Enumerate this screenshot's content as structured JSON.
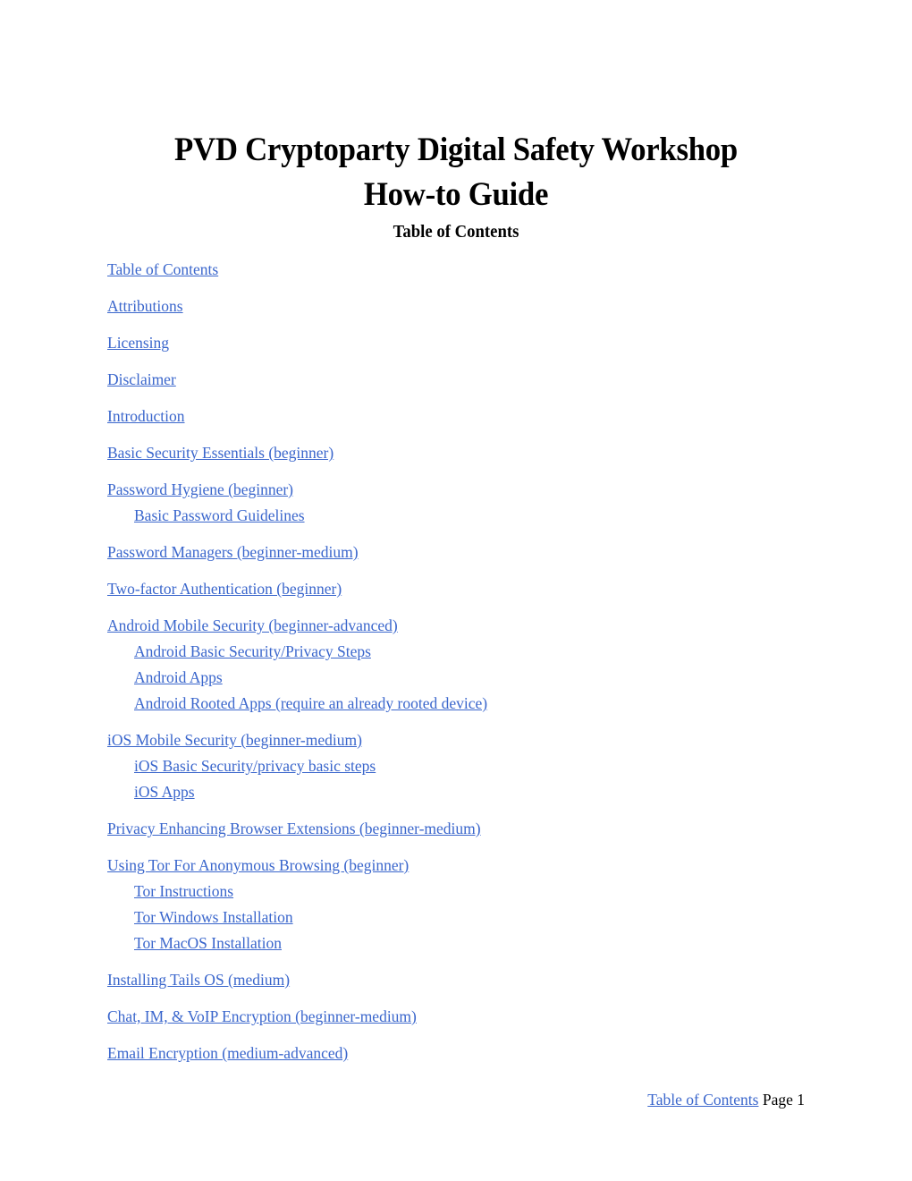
{
  "document": {
    "title_line_1": "PVD Cryptoparty Digital Safety Workshop",
    "title_line_2": "How-to Guide",
    "toc_heading": "Table of Contents",
    "link_color": "#3a66cc",
    "text_color": "#000000",
    "page_background": "#ffffff"
  },
  "toc": {
    "entries": [
      {
        "label": "Table of Contents",
        "level": 1
      },
      {
        "label": "Attributions",
        "level": 1
      },
      {
        "label": "Licensing",
        "level": 1
      },
      {
        "label": "Disclaimer",
        "level": 1
      },
      {
        "label": "Introduction",
        "level": 1
      },
      {
        "label": "Basic Security Essentials (beginner)",
        "level": 1
      },
      {
        "label": "Password Hygiene (beginner)",
        "level": 1
      },
      {
        "label": "Basic Password Guidelines",
        "level": 2
      },
      {
        "label": "Password Managers (beginner-medium)",
        "level": 1
      },
      {
        "label": "Two-factor Authentication (beginner)",
        "level": 1
      },
      {
        "label": "Android Mobile Security (beginner-advanced)",
        "level": 1
      },
      {
        "label": "Android Basic Security/Privacy Steps",
        "level": 2
      },
      {
        "label": "Android Apps",
        "level": 2
      },
      {
        "label": "Android Rooted Apps (require an already rooted device)",
        "level": 2
      },
      {
        "label": "iOS Mobile Security (beginner-medium)",
        "level": 1
      },
      {
        "label": "iOS Basic Security/privacy basic steps",
        "level": 2
      },
      {
        "label": "iOS Apps",
        "level": 2
      },
      {
        "label": "Privacy Enhancing Browser Extensions (beginner-medium)",
        "level": 1
      },
      {
        "label": "Using Tor For Anonymous Browsing (beginner)",
        "level": 1
      },
      {
        "label": "Tor Instructions",
        "level": 2
      },
      {
        "label": "Tor Windows Installation",
        "level": 2
      },
      {
        "label": "Tor MacOS Installation",
        "level": 2
      },
      {
        "label": "Installing Tails OS (medium)",
        "level": 1
      },
      {
        "label": "Chat, IM, & VoIP Encryption (beginner-medium)",
        "level": 1
      },
      {
        "label": "Email Encryption (medium-advanced)",
        "level": 1
      }
    ]
  },
  "footer": {
    "link_label": "Table of Contents",
    "page_label": " Page 1"
  }
}
